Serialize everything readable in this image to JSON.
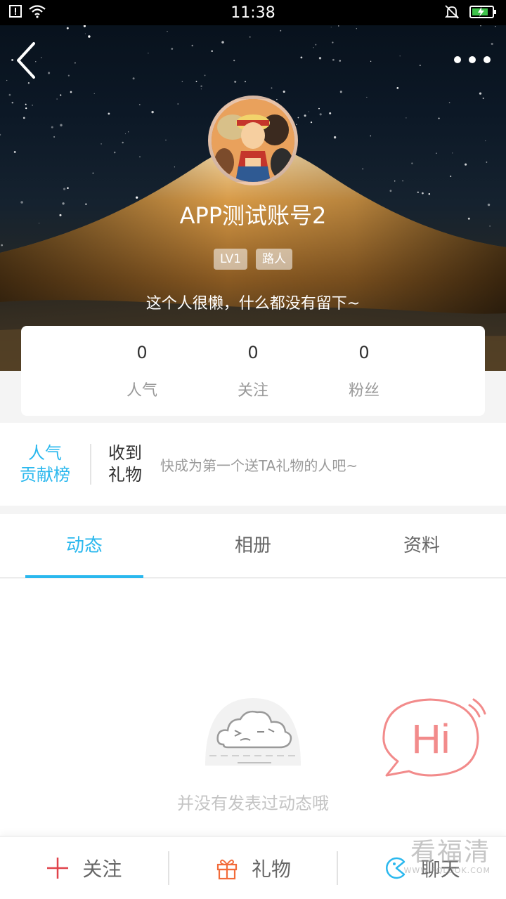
{
  "status_bar": {
    "time": "11:38",
    "icons": [
      "sim-alert-icon",
      "wifi-icon",
      "mute-bell-icon",
      "battery-charging-icon"
    ]
  },
  "header": {
    "back_icon": "chevron-left-icon",
    "more_icon": "more-dots-icon",
    "avatar": "avatar-image",
    "username": "APP测试账号2",
    "badges": [
      "LV1",
      "路人"
    ],
    "bio": "这个人很懒，什么都没有留下~"
  },
  "stats": [
    {
      "value": "0",
      "label": "人气"
    },
    {
      "value": "0",
      "label": "关注"
    },
    {
      "value": "0",
      "label": "粉丝"
    }
  ],
  "gifts": {
    "rank_line1": "人气",
    "rank_line2": "贡献榜",
    "title_line1": "收到",
    "title_line2": "礼物",
    "empty_text": "快成为第一个送TA礼物的人吧~"
  },
  "tabs": [
    {
      "label": "动态",
      "active": true
    },
    {
      "label": "相册",
      "active": false
    },
    {
      "label": "资料",
      "active": false
    }
  ],
  "empty_state": {
    "icon": "sleepy-cloud-icon",
    "text": "并没有发表过动态哦",
    "hi_label": "Hi"
  },
  "bottom_bar": {
    "follow_label": "关注",
    "gift_label": "礼物",
    "chat_label": "聊天"
  },
  "watermark": {
    "big": "看福清",
    "small": "WWW.FQLOOK.COM"
  },
  "colors": {
    "accent": "#2bb8ee",
    "follow": "#e0434b",
    "gift": "#f26b3a",
    "hi": "#f28b8b"
  }
}
